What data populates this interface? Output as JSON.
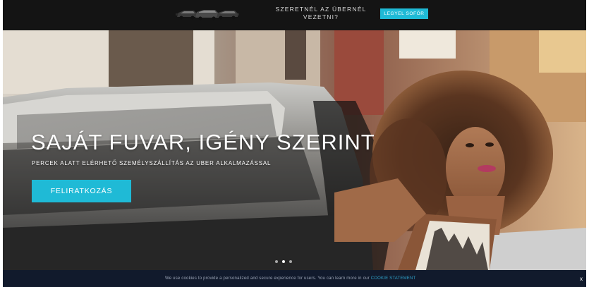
{
  "topbar": {
    "banner_text": "SZERETNÉL AZ ÜBERNÉL VEZETNI?",
    "driver_button": "LEGYEL SOFŐR",
    "cars_icon": "black-cars-icon"
  },
  "hero": {
    "headline": "SAJÁT FUVAR, IGÉNY SZERINT",
    "subline": "PERCEK ALATT ELÉRHETŐ SZEMÉLYSZÁLLÍTÁS AZ UBER ALKALMAZÁSSAL",
    "signup_button": "FELIRATKOZÁS",
    "slides": 3,
    "active_slide": 2
  },
  "cookie": {
    "text": "We use cookies to provide a personalized and secure experience for users. You can learn more in our",
    "link": "COOKIE STATEMENT",
    "close": "x"
  },
  "colors": {
    "accent": "#1fbad6",
    "topbar": "#141414",
    "cookie_bar": "#111a2c"
  }
}
